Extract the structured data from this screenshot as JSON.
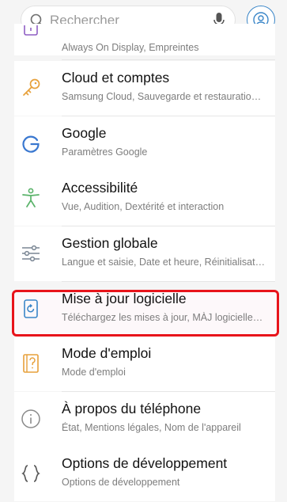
{
  "search": {
    "placeholder": "Rechercher"
  },
  "settings": [
    {
      "title": "",
      "subtitle": "Always On Display, Empreintes",
      "icon": "lock-screen-icon"
    },
    {
      "title": "Cloud et comptes",
      "subtitle": "Samsung Cloud, Sauvegarde et restauratio…",
      "icon": "key-icon"
    },
    {
      "title": "Google",
      "subtitle": "Paramètres Google",
      "icon": "google-icon"
    },
    {
      "title": "Accessibilité",
      "subtitle": "Vue, Audition, Dextérité et interaction",
      "icon": "accessibility-icon"
    },
    {
      "title": "Gestion globale",
      "subtitle": "Langue et saisie, Date et heure, Réinitialisat…",
      "icon": "sliders-icon"
    },
    {
      "title": "Mise à jour logicielle",
      "subtitle": "Téléchargez les mises à jour, MÀJ logicielle…",
      "icon": "software-update-icon"
    },
    {
      "title": "Mode d'emploi",
      "subtitle": "Mode d'emploi",
      "icon": "manual-icon"
    },
    {
      "title": "À propos du téléphone",
      "subtitle": "État, Mentions légales, Nom de l'appareil",
      "icon": "info-icon"
    },
    {
      "title": "Options de développement",
      "subtitle": "Options de développement",
      "icon": "developer-braces-icon"
    }
  ],
  "colors": {
    "highlight": "#e8141b",
    "accent": "#3a86c8"
  }
}
